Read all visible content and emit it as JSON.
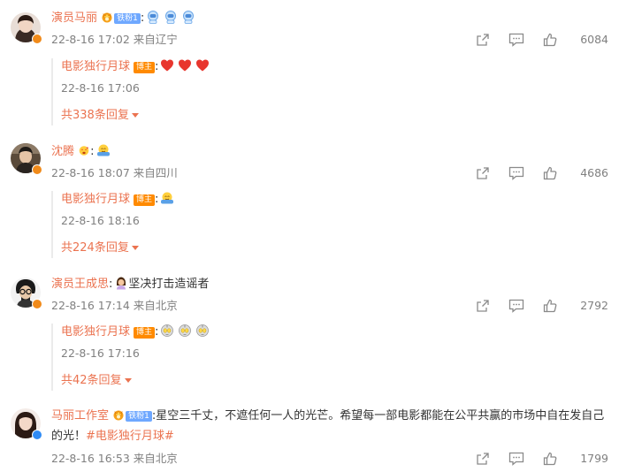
{
  "comments": [
    {
      "user": "演员马丽",
      "fan_badge": "铁粉1",
      "text": ":",
      "meta": "22-8-16 17:02 来自辽宁",
      "likes": "6084",
      "reply": {
        "user": "电影独行月球",
        "badge": "博主",
        "text": ":",
        "time": "22-8-16 17:06",
        "count_label": "共338条回复"
      }
    },
    {
      "user": "沈腾",
      "text": ":",
      "meta": "22-8-16 18:07 来自四川",
      "likes": "4686",
      "reply": {
        "user": "电影独行月球",
        "badge": "博主",
        "text": ":",
        "time": "22-8-16 18:16",
        "count_label": "共224条回复"
      }
    },
    {
      "user": "演员王成思",
      "text": ":",
      "text_after": "坚决打击造谣者",
      "meta": "22-8-16 17:14 来自北京",
      "likes": "2792",
      "reply": {
        "user": "电影独行月球",
        "badge": "博主",
        "text": ":",
        "time": "22-8-16 17:16",
        "count_label": "共42条回复"
      }
    },
    {
      "user": "马丽工作室",
      "fan_badge": "铁粉1",
      "text": ":星空三千丈，不遮任何一人的光芒。希望每一部电影都能在公平共赢的市场中自在发自己的光！",
      "hashtag": "#电影独行月球#",
      "meta": "22-8-16 16:53 来自北京",
      "likes": "1799"
    }
  ],
  "icons": {
    "share": "share-icon",
    "comment": "comment-icon",
    "like": "thumbs-up-icon",
    "verified": "verified-badge-icon"
  },
  "colors": {
    "username": "#eb7350",
    "meta": "#808080",
    "bozhu_badge": "#ff8a00",
    "fan_badge": "#6fa8ff"
  }
}
